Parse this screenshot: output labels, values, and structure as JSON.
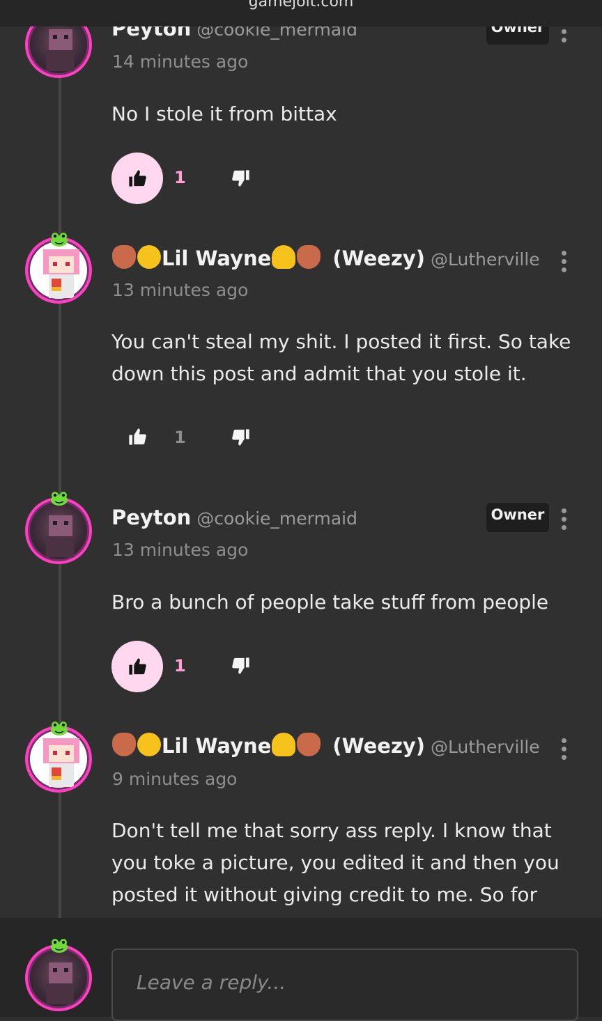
{
  "browser": {
    "url": "gamejolt.com"
  },
  "comments": [
    {
      "author": "Peyton",
      "handle": "@cookie_mermaid",
      "badge": "Owner",
      "time": "14 minutes ago",
      "text": "No I stole it from bittax",
      "likes": "1",
      "liked": true
    },
    {
      "author": "Lil Wayne",
      "author_suffix": "(Weezy)",
      "handle": "@Lutherville",
      "time": "13 minutes ago",
      "text": "You can't steal my shit. I posted it first. So take down this post and admit that you stole it.",
      "likes": "1",
      "liked": false
    },
    {
      "author": "Peyton",
      "handle": "@cookie_mermaid",
      "badge": "Owner",
      "time": "13 minutes ago",
      "text": "Bro a bunch of people take stuff from people",
      "likes": "1",
      "liked": true
    },
    {
      "author": "Lil Wayne",
      "author_suffix": "(Weezy)",
      "handle": "@Lutherville",
      "time": "9 minutes ago",
      "text": "Don't tell me that sorry ass reply. I know that you toke a picture, you edited it and then you posted it without giving credit to me. So for"
    }
  ],
  "reply": {
    "placeholder": "Leave a reply..."
  },
  "icons": {
    "like": "thumbs-up-icon",
    "dislike": "thumbs-down-icon",
    "more": "more-vertical-icon",
    "name_emoji": [
      "brown-heart-icon",
      "grinning-face-icon",
      "melting-face-icon",
      "brown-heart-icon"
    ]
  },
  "colors": {
    "background": "#303030",
    "avatar_ring": "#ff3fc0",
    "liked_bg": "#ffd7ee",
    "liked_count": "#ff9fd6"
  }
}
